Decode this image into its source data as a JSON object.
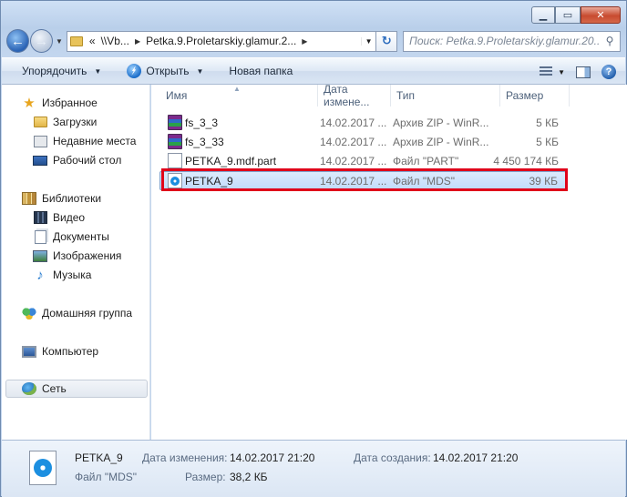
{
  "window": {
    "caption": {
      "minimize_icon": "minimize-icon",
      "maximize_icon": "maximize-icon",
      "close_icon": "close-icon"
    }
  },
  "nav": {
    "address": {
      "overflow": "«",
      "segments": [
        "\\\\Vb...",
        "Petka.9.Proletarskiy.glamur.2..."
      ]
    },
    "search_placeholder": "Поиск: Petka.9.Proletarskiy.glamur.20..."
  },
  "toolbar": {
    "organize": "Упорядочить",
    "open": "Открыть",
    "new_folder": "Новая папка"
  },
  "navpane": {
    "favorites": {
      "label": "Избранное",
      "items": [
        "Загрузки",
        "Недавние места",
        "Рабочий стол"
      ]
    },
    "libraries": {
      "label": "Библиотеки",
      "items": [
        "Видео",
        "Документы",
        "Изображения",
        "Музыка"
      ]
    },
    "homegroup": "Домашняя группа",
    "computer": "Компьютер",
    "network": "Сеть"
  },
  "filelist": {
    "columns": {
      "name": "Имя",
      "date": "Дата измене...",
      "type": "Тип",
      "size": "Размер"
    },
    "rows": [
      {
        "name": "fs_3_3",
        "date": "14.02.2017 ...",
        "type": "Архив ZIP - WinR...",
        "size": "5 КБ",
        "icon": "winrar-archive-icon"
      },
      {
        "name": "fs_3_33",
        "date": "14.02.2017 ...",
        "type": "Архив ZIP - WinR...",
        "size": "5 КБ",
        "icon": "winrar-archive-icon"
      },
      {
        "name": "PETKA_9.mdf.part",
        "date": "14.02.2017 ...",
        "type": "Файл \"PART\"",
        "size": "4 450 174 КБ",
        "icon": "blank-file-icon"
      },
      {
        "name": "PETKA_9",
        "date": "14.02.2017 ...",
        "type": "Файл \"MDS\"",
        "size": "39 КБ",
        "icon": "disc-image-file-icon",
        "selected": true
      }
    ]
  },
  "details": {
    "name": "PETKA_9",
    "type": "Файл \"MDS\"",
    "modified_label": "Дата изменения:",
    "modified_value": "14.02.2017 21:20",
    "size_label": "Размер:",
    "size_value": "38,2 КБ",
    "created_label": "Дата создания:",
    "created_value": "14.02.2017 21:20"
  },
  "colors": {
    "highlight_border": "#e0001a",
    "selection_fill": "#c1dbfc"
  }
}
